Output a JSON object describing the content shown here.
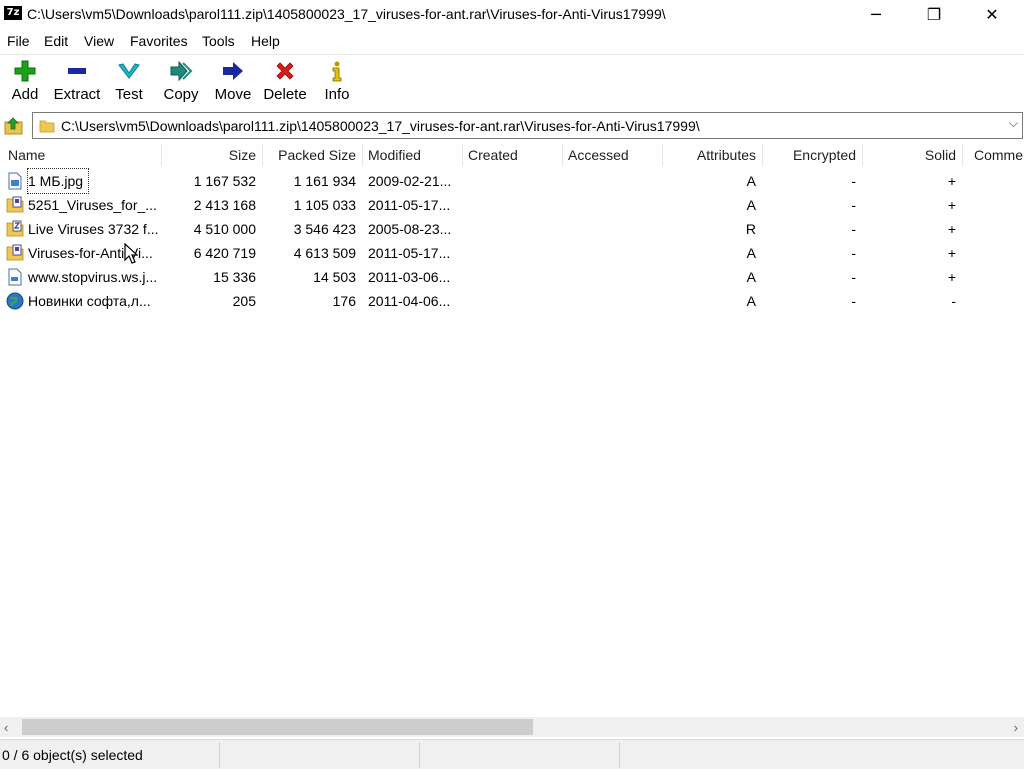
{
  "window": {
    "title": "C:\\Users\\vm5\\Downloads\\parol111.zip\\1405800023_17_viruses-for-ant.rar\\Viruses-for-Anti-Virus17999\\",
    "app_icon": "7z",
    "controls": [
      "─",
      "❐",
      "✕"
    ]
  },
  "menu": [
    "File",
    "Edit",
    "View",
    "Favorites",
    "Tools",
    "Help"
  ],
  "toolbar": [
    {
      "label": "Add",
      "icon": "plus-icon",
      "color": "#1aa31a"
    },
    {
      "label": "Extract",
      "icon": "minus-icon",
      "color": "#1a2a9e"
    },
    {
      "label": "Test",
      "icon": "check-icon",
      "color": "#1fb4c8"
    },
    {
      "label": "Copy",
      "icon": "double-arrow-icon",
      "color": "#1f8a7a"
    },
    {
      "label": "Move",
      "icon": "arrow-right-icon",
      "color": "#1a2a9e"
    },
    {
      "label": "Delete",
      "icon": "x-icon",
      "color": "#d81b1b"
    },
    {
      "label": "Info",
      "icon": "info-icon",
      "color": "#b59b00"
    }
  ],
  "address": {
    "path": "C:\\Users\\vm5\\Downloads\\parol111.zip\\1405800023_17_viruses-for-ant.rar\\Viruses-for-Anti-Virus17999\\"
  },
  "columns": [
    "Name",
    "Size",
    "Packed Size",
    "Modified",
    "Created",
    "Accessed",
    "Attributes",
    "Encrypted",
    "Solid",
    "Comme"
  ],
  "files": [
    {
      "icon": "image-file-icon",
      "name": "1 МБ.jpg",
      "size": "1 167 532",
      "packed": "1 161 934",
      "modified": "2009-02-21...",
      "created": "",
      "accessed": "",
      "attributes": "A",
      "encrypted": "-",
      "solid": "+",
      "comment": ""
    },
    {
      "icon": "rar-archive-icon",
      "name": "5251_Viruses_for_...",
      "size": "2 413 168",
      "packed": "1 105 033",
      "modified": "2011-05-17...",
      "created": "",
      "accessed": "",
      "attributes": "A",
      "encrypted": "-",
      "solid": "+",
      "comment": ""
    },
    {
      "icon": "zip-archive-icon",
      "name": "Live Viruses 3732 f...",
      "size": "4 510 000",
      "packed": "3 546 423",
      "modified": "2005-08-23...",
      "created": "",
      "accessed": "",
      "attributes": "R",
      "encrypted": "-",
      "solid": "+",
      "comment": ""
    },
    {
      "icon": "rar-archive-icon",
      "name": "Viruses-for-Anti-Vi...",
      "size": "6 420 719",
      "packed": "4 613 509",
      "modified": "2011-05-17...",
      "created": "",
      "accessed": "",
      "attributes": "A",
      "encrypted": "-",
      "solid": "+",
      "comment": ""
    },
    {
      "icon": "document-file-icon",
      "name": "www.stopvirus.ws.j...",
      "size": "15 336",
      "packed": "14 503",
      "modified": "2011-03-06...",
      "created": "",
      "accessed": "",
      "attributes": "A",
      "encrypted": "-",
      "solid": "+",
      "comment": ""
    },
    {
      "icon": "globe-link-icon",
      "name": "Новинки софта,л...",
      "size": "205",
      "packed": "176",
      "modified": "2011-04-06...",
      "created": "",
      "accessed": "",
      "attributes": "A",
      "encrypted": "-",
      "solid": "-",
      "comment": ""
    }
  ],
  "scrollbar": {
    "left_arrow": "‹",
    "right_arrow": "›"
  },
  "status": {
    "selection": "0 / 6 object(s) selected"
  }
}
